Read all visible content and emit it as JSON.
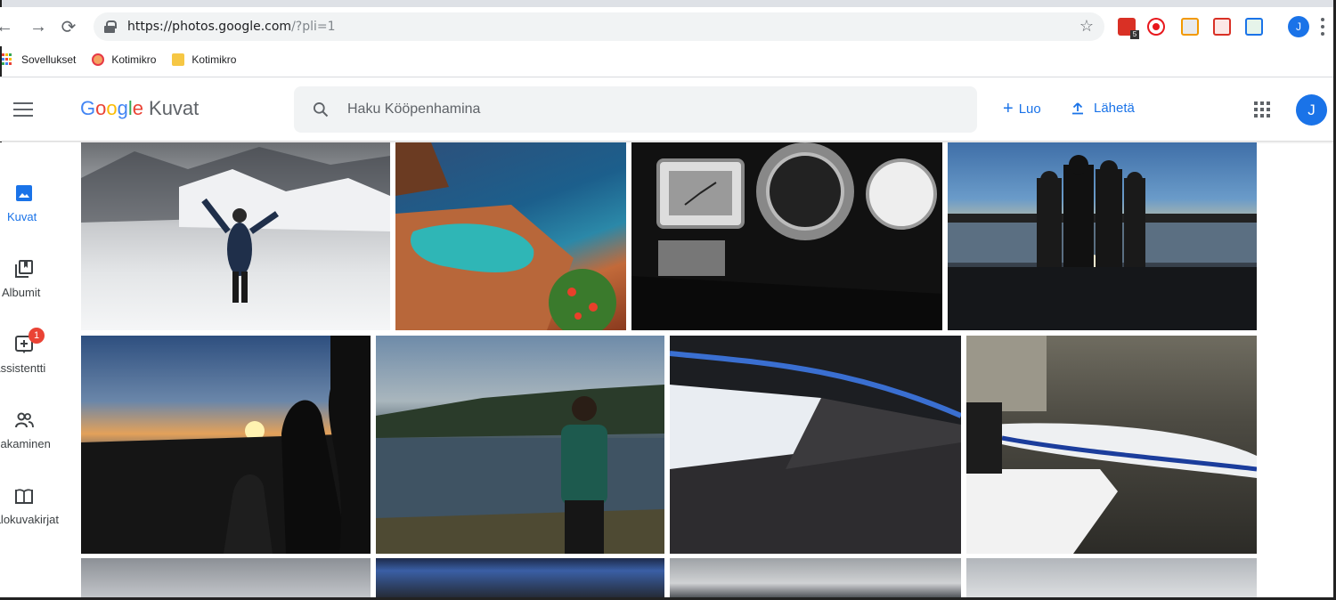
{
  "browser": {
    "url_main": "https://photos.google.com",
    "url_rest": "/?pli=1",
    "profile_initial": "J",
    "bookmarks": [
      {
        "label": "Sovellukset"
      },
      {
        "label": "Kotimikro"
      },
      {
        "label": "Kotimikro"
      }
    ]
  },
  "header": {
    "logo_letters": [
      "G",
      "o",
      "o",
      "g",
      "l",
      "e"
    ],
    "product": "Kuvat",
    "search_placeholder": "Haku Kööpenhamina",
    "create_label": "Luo",
    "upload_label": "Lähetä",
    "avatar_initial": "J"
  },
  "sidebar": {
    "items": [
      {
        "label": "Kuvat"
      },
      {
        "label": "Albumit"
      },
      {
        "label": "Assistentti",
        "badge": "1"
      },
      {
        "label": "Jakaminen"
      },
      {
        "label": "Valokuvakirjat"
      }
    ]
  },
  "colors": {
    "accent": "#1a73e8",
    "badge": "#ea4335"
  },
  "photos": [
    {
      "subject": "snow-mountain"
    },
    {
      "subject": "pool-coast"
    },
    {
      "subject": "watches"
    },
    {
      "subject": "lake-sunset-group"
    },
    {
      "subject": "sunset-couple"
    },
    {
      "subject": "lake-man"
    },
    {
      "subject": "hockey-arena"
    },
    {
      "subject": "boat-garage"
    },
    {
      "subject": "cloudy-sky"
    },
    {
      "subject": "arena-2"
    },
    {
      "subject": "sky-mountain"
    },
    {
      "subject": "sky-4"
    }
  ]
}
